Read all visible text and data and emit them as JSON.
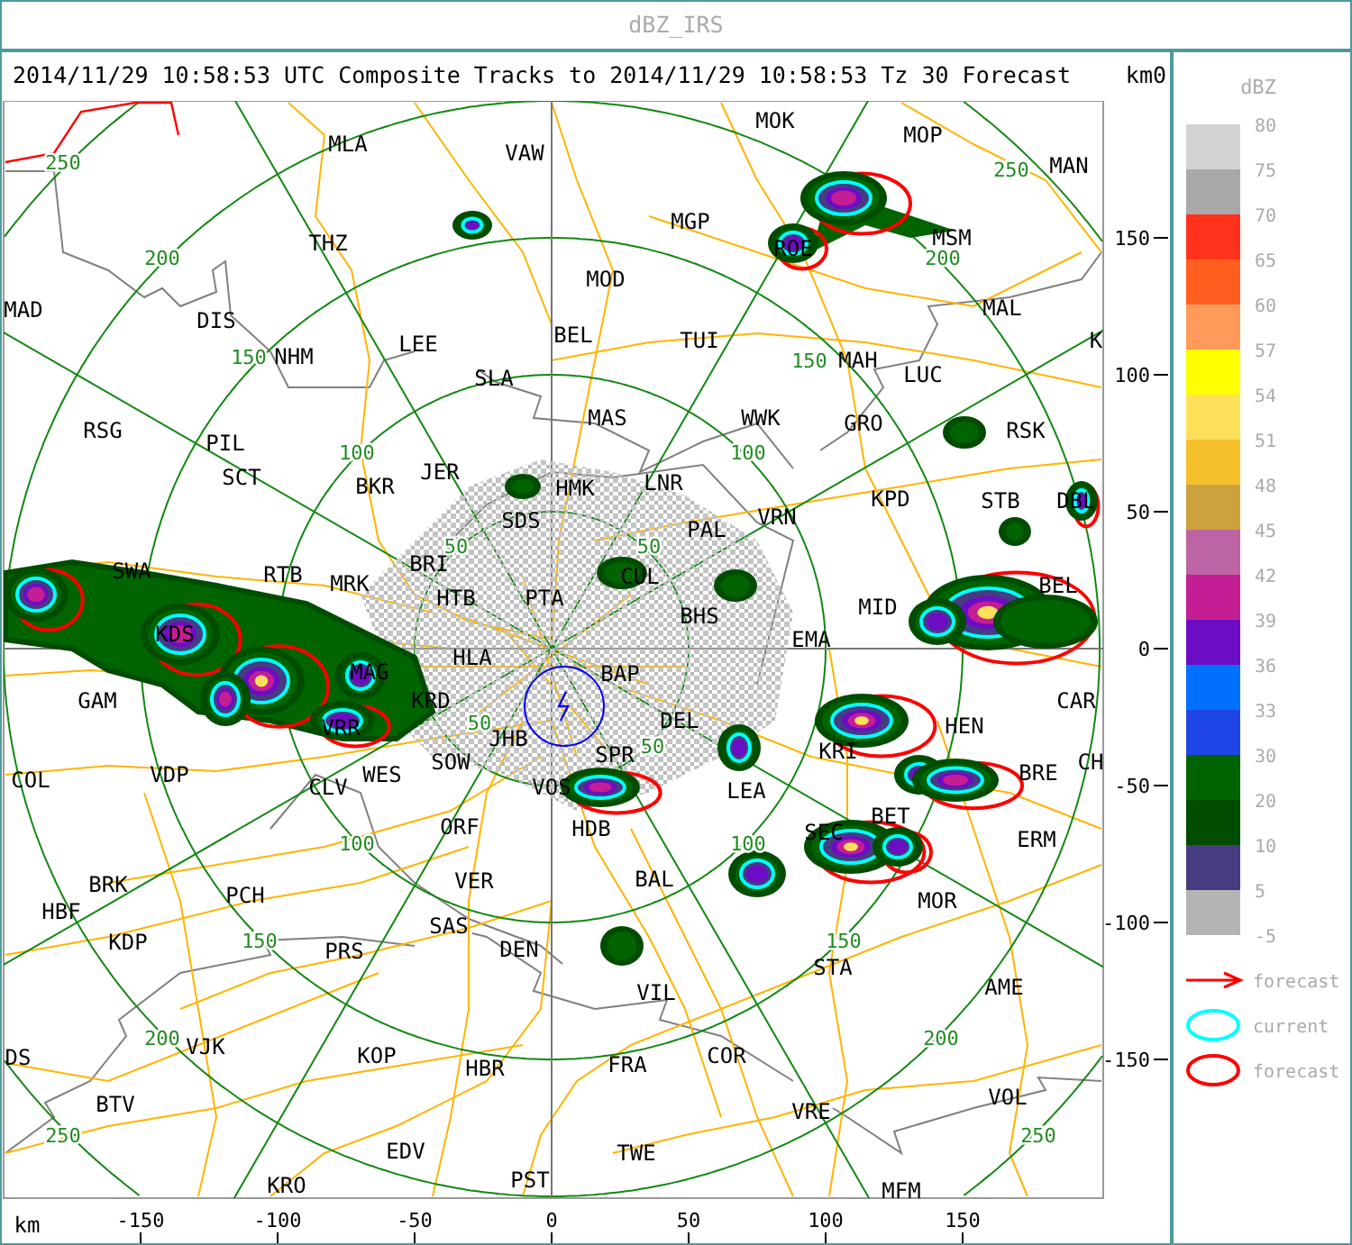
{
  "window": {
    "title": "dBZ_IRS"
  },
  "header": {
    "text": "2014/11/29 10:58:53 UTC Composite Tracks to 2014/11/29 10:58:53 Tz 30 Forecast",
    "corner_label": "km0"
  },
  "map": {
    "cities": [
      "MLA",
      "VAW",
      "THZ",
      "MAD",
      "DIS",
      "LEE",
      "NHM",
      "SLA",
      "RSG",
      "PIL",
      "SCT",
      "BKR",
      "JER",
      "SDS",
      "SWA",
      "RTB",
      "MRK",
      "BRI",
      "HTB",
      "PTA",
      "KDS",
      "HLA",
      "GAM",
      "MAG",
      "KRD",
      "VRR",
      "SOW",
      "JHB",
      "WES",
      "VOS",
      "COL",
      "VDP",
      "CLV",
      "ORF",
      "BRK",
      "HBF",
      "VER",
      "PCH",
      "SAS",
      "KDP",
      "PRS",
      "DEN",
      "VJK",
      "KOP",
      "HBR",
      "DS",
      "BTV",
      "EDV",
      "KRO",
      "PST",
      "MOK",
      "MOP",
      "MAN",
      "MGP",
      "MSM",
      "ROE",
      "MOD",
      "MAL",
      "BEL",
      "TUI",
      "MAH",
      "K",
      "LUC",
      "MAS",
      "WWK",
      "GRO",
      "RSK",
      "HMK",
      "LNR",
      "KPD",
      "STB",
      "DBL",
      "PAL",
      "VRN",
      "CUL",
      "BHS",
      "MID",
      "BEL",
      "EMA",
      "BAP",
      "DEL",
      "CAR",
      "HEN",
      "KRI",
      "SPR",
      "BRE",
      "CH",
      "LEA",
      "HDB",
      "SEC",
      "BET",
      "ERM",
      "BAL",
      "MOR",
      "STA",
      "AME",
      "VIL",
      "FRA",
      "COR",
      "VRE",
      "VOL",
      "TWE",
      "MFM"
    ],
    "range_labels": [
      "250",
      "200",
      "150",
      "100",
      "50",
      "50",
      "100",
      "150",
      "200",
      "250",
      "50",
      "100",
      "150",
      "200",
      "250",
      "50",
      "100",
      "150",
      "200",
      "250"
    ],
    "y_axis": {
      "labels": [
        "150",
        "100",
        "50",
        "0",
        "-50",
        "-100",
        "-150"
      ]
    },
    "x_axis": {
      "unit": "km",
      "labels": [
        "-150",
        "-100",
        "-50",
        "0",
        "50",
        "100",
        "150"
      ]
    }
  },
  "legend": {
    "title": "dBZ",
    "scale": [
      {
        "label": "80",
        "color": "#d3d3d3"
      },
      {
        "label": "75",
        "color": "#a9a9a9"
      },
      {
        "label": "70",
        "color": "#ff321c"
      },
      {
        "label": "65",
        "color": "#ff5f1e"
      },
      {
        "label": "60",
        "color": "#ff9a5a"
      },
      {
        "label": "57",
        "color": "#ffff00"
      },
      {
        "label": "54",
        "color": "#ffe05a"
      },
      {
        "label": "51",
        "color": "#f4c02c"
      },
      {
        "label": "48",
        "color": "#cca23e"
      },
      {
        "label": "45",
        "color": "#bc64a4"
      },
      {
        "label": "42",
        "color": "#c41e94"
      },
      {
        "label": "39",
        "color": "#6c0cc4"
      },
      {
        "label": "36",
        "color": "#0070ff"
      },
      {
        "label": "33",
        "color": "#1e46e6"
      },
      {
        "label": "30",
        "color": "#006400"
      },
      {
        "label": "20",
        "color": "#004c00"
      },
      {
        "label": "10",
        "color": "#463c82"
      },
      {
        "label": "5",
        "color": "#b4b4b4"
      }
    ],
    "bottom_label": "-5",
    "items": [
      {
        "kind": "arrow",
        "label": "forecast"
      },
      {
        "kind": "current_outline",
        "label": "current"
      },
      {
        "kind": "forecast_outline",
        "label": "forecast"
      }
    ]
  }
}
